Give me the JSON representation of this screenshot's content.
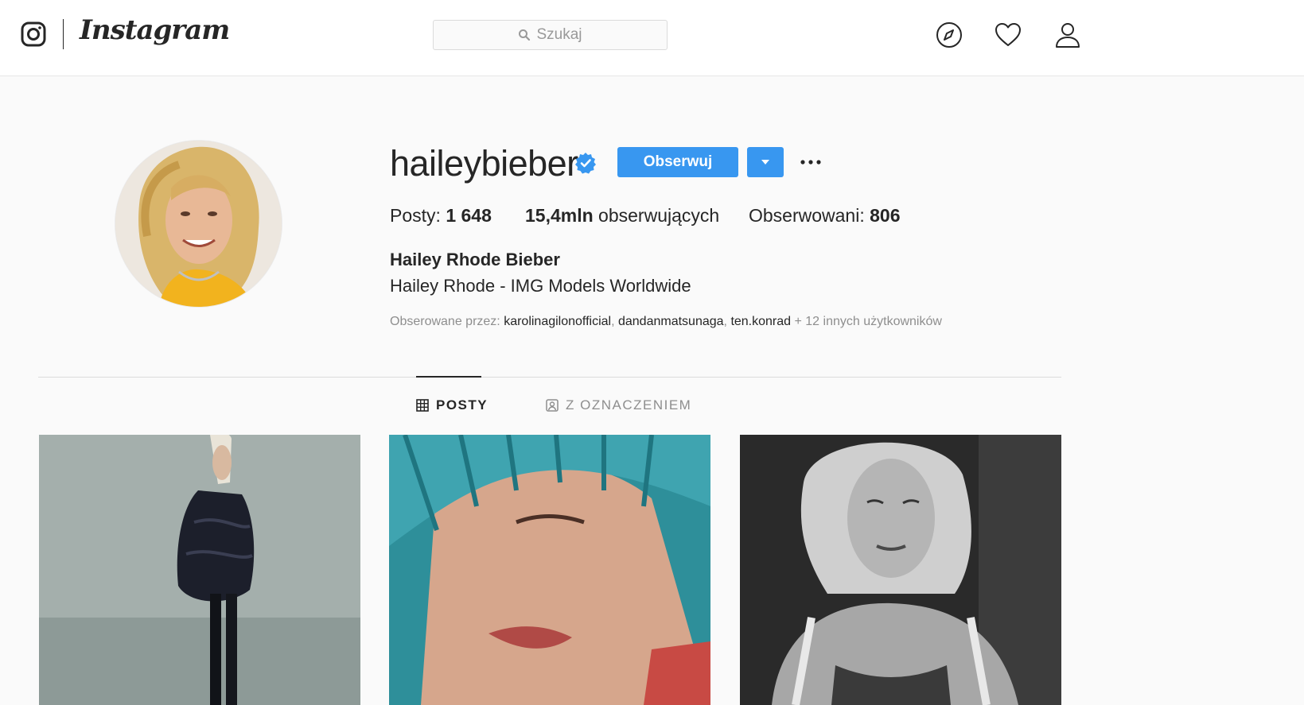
{
  "nav": {
    "wordmark": "Instagram",
    "search_placeholder": "Szukaj"
  },
  "profile": {
    "username": "haileybieber",
    "verified": true,
    "follow_label": "Obserwuj",
    "stats": {
      "posts_label": "Posty: ",
      "posts_value": "1 648",
      "followers_value": "15,4mln",
      "followers_label": " obserwujących",
      "following_label": "Obserwowani: ",
      "following_value": "806"
    },
    "full_name": "Hailey Rhode Bieber",
    "bio": "Hailey Rhode - IMG Models Worldwide",
    "followed_by": {
      "prefix": "Obserowane przez: ",
      "accounts": [
        "karolinagilonofficial",
        "dandanmatsunaga",
        "ten.konrad"
      ],
      "separator": ", ",
      "suffix": " + 12 innych użytkowników"
    }
  },
  "tabs": [
    {
      "label": "POSTY",
      "active": true
    },
    {
      "label": "Z OZNACZENIEM",
      "active": false
    }
  ],
  "colors": {
    "accent": "#3897f0",
    "text": "#262626",
    "muted": "#8e8e8e",
    "background": "#fafafa"
  },
  "icons": [
    "instagram-glyph-icon",
    "search-icon",
    "compass-icon",
    "heart-icon",
    "profile-icon",
    "verified-badge-icon",
    "caret-down-icon",
    "more-dots-icon",
    "grid-icon",
    "tagged-icon"
  ]
}
